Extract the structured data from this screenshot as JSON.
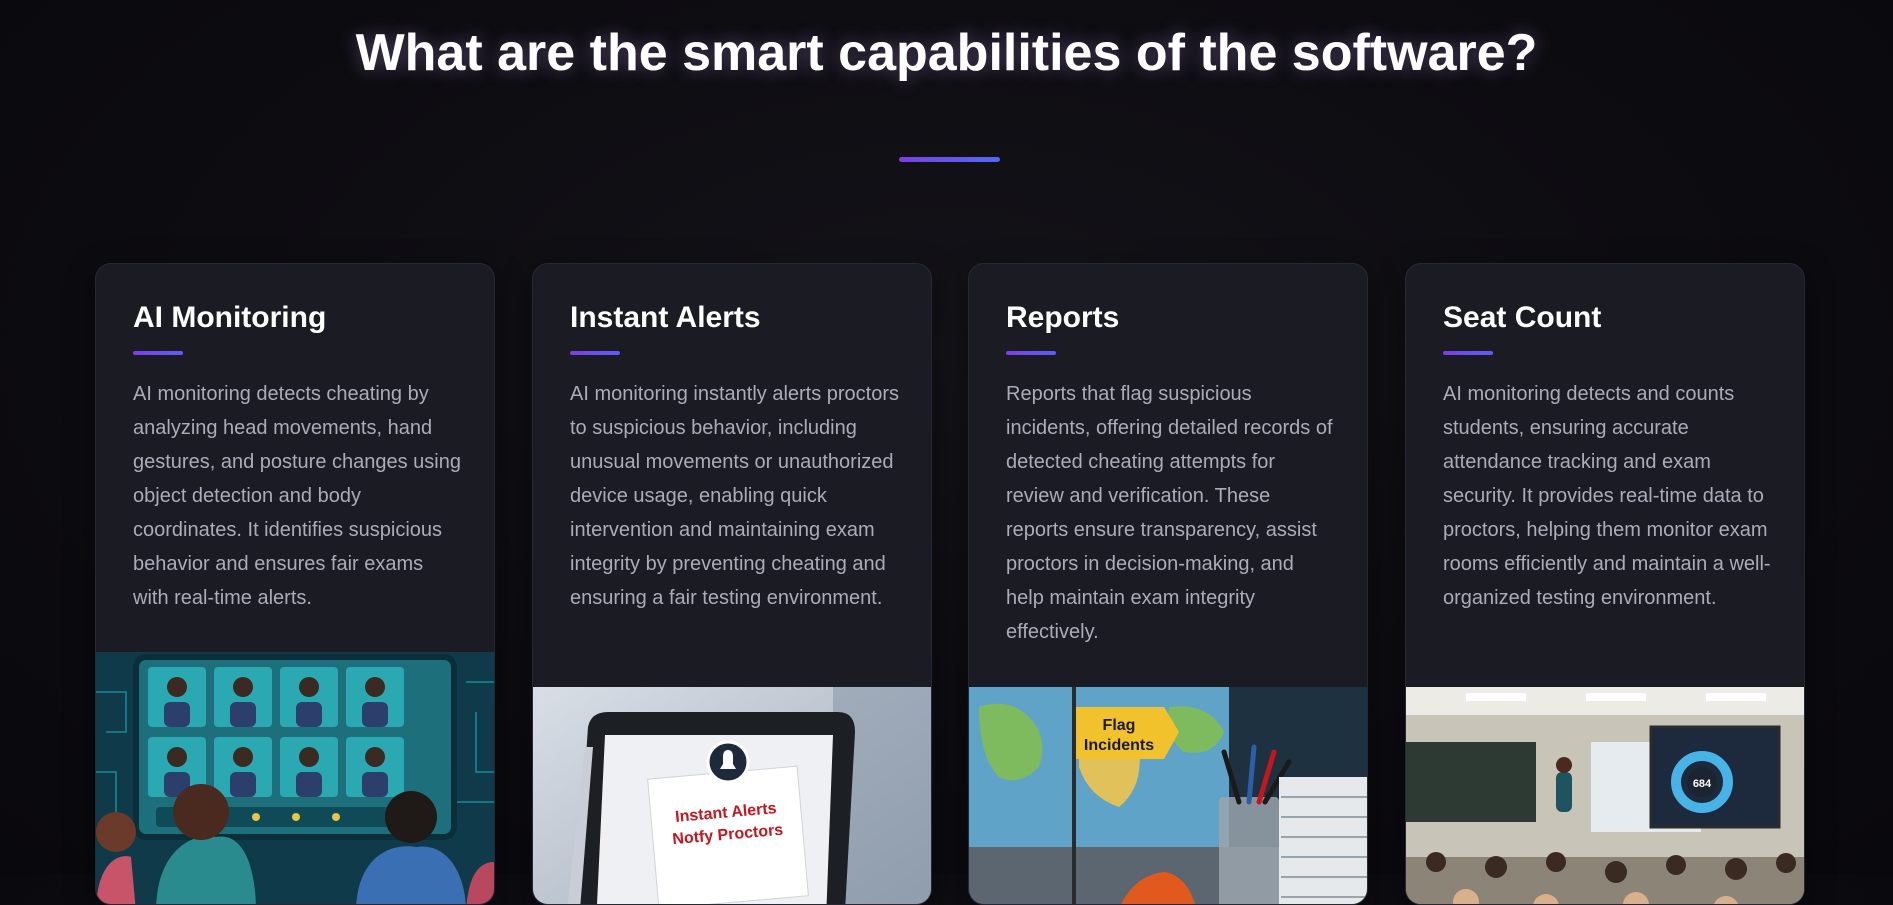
{
  "section": {
    "heading": "What are the smart capabilities of the software?"
  },
  "cards": [
    {
      "title": "AI Monitoring",
      "description": "AI monitoring detects cheating by analyzing head movements, hand gestures, and posture changes using object detection and body coordinates. It identifies suspicious behavior and ensures fair exams with real-time alerts.",
      "image_alt": "illustration of students watching a monitoring screen"
    },
    {
      "title": "Instant Alerts",
      "description": "AI monitoring instantly alerts proctors to suspicious behavior, including unusual movements or unauthorized device usage, enabling quick intervention and maintaining exam integrity by preventing cheating and ensuring a fair testing environment.",
      "image_text_line1": "Instant Alerts",
      "image_text_line2": "Notfy Proctors"
    },
    {
      "title": "Reports",
      "description": "Reports that flag suspicious incidents, offering detailed records of detected cheating attempts for review and verification. These reports ensure transparency, assist proctors in decision-making, and help maintain exam integrity effectively.",
      "image_text_line1": "Flag",
      "image_text_line2": "Incidents"
    },
    {
      "title": "Seat Count",
      "description": "AI monitoring detects and counts students, ensuring accurate attendance tracking and exam security. It provides real-time data to proctors, helping them monitor exam rooms efficiently and maintain a well-organized testing environment.",
      "image_text_line1": "684"
    }
  ],
  "colors": {
    "background": "#0d0c11",
    "card_background": "#1a1b23",
    "accent_purple": "#7b3fe4",
    "accent_blue": "#4f6cf0",
    "body_text": "#a9adb8"
  }
}
